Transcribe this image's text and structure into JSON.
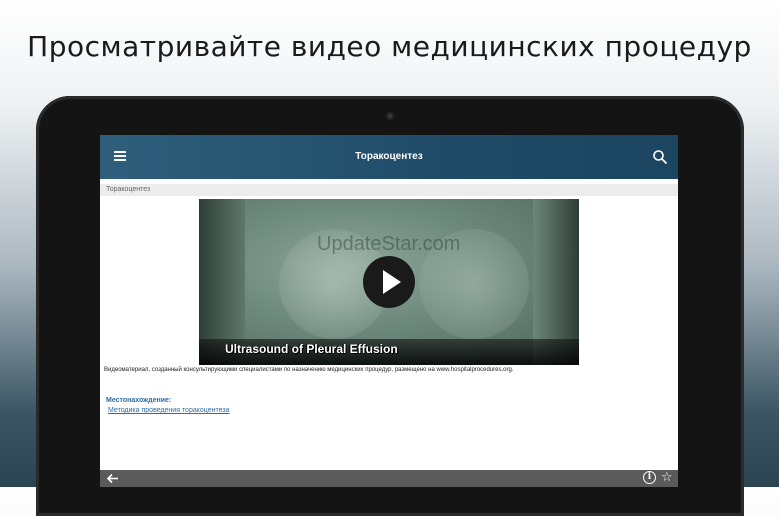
{
  "headline": "Просматривайте видео медицинских процедур",
  "appbar": {
    "title": "Торакоцентез"
  },
  "breadcrumb": "Торакоцентез",
  "video": {
    "watermark": "UpdateStar.com",
    "caption": "Ultrasound of Pleural Effusion"
  },
  "description": "Видеоматериал, созданный консультирующими специалистами по назначению медицинских процедур, размещено на www.hospitalprocedures.org.",
  "location": {
    "title": "Местонахождение:",
    "link": "Методика проведения торакоцентеза"
  },
  "bottombar": {
    "info_glyph": "i",
    "star_glyph": "☆"
  },
  "colors": {
    "appbar": "#1f4b68",
    "link": "#2d6da3",
    "bottombar": "#5a5a5a"
  }
}
